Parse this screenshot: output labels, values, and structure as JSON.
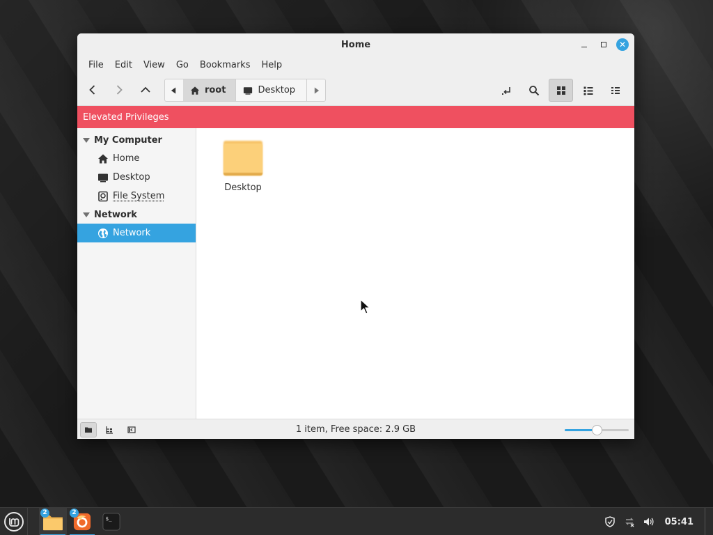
{
  "window": {
    "title": "Home"
  },
  "menubar": {
    "items": [
      "File",
      "Edit",
      "View",
      "Go",
      "Bookmarks",
      "Help"
    ]
  },
  "pathbar": {
    "crumbs": [
      {
        "label": "root",
        "icon": "home-icon",
        "active": true
      },
      {
        "label": "Desktop",
        "icon": "desktop-icon",
        "active": false
      }
    ]
  },
  "banner": {
    "text": "Elevated Privileges",
    "color": "#ef5060"
  },
  "sidebar": {
    "sections": [
      {
        "heading": "My Computer",
        "items": [
          {
            "label": "Home",
            "icon": "home-icon"
          },
          {
            "label": "Desktop",
            "icon": "desktop-icon"
          },
          {
            "label": "File System",
            "icon": "drive-icon"
          }
        ]
      },
      {
        "heading": "Network",
        "items": [
          {
            "label": "Network",
            "icon": "globe-icon",
            "selected": true
          }
        ]
      }
    ]
  },
  "files": [
    {
      "name": "Desktop",
      "icon": "folder-icon"
    }
  ],
  "statusbar": {
    "text": "1 item, Free space: 2.9 GB",
    "zoom_fraction": 0.5
  },
  "taskbar": {
    "apps": [
      {
        "name": "files",
        "icon": "folder-icon",
        "badge": "2"
      },
      {
        "name": "firefox",
        "icon": "firefox-icon",
        "badge": "2"
      },
      {
        "name": "terminal",
        "icon": "terminal-icon",
        "badge": ""
      }
    ],
    "clock": "05:41"
  },
  "colors": {
    "accent": "#35a3e0",
    "banner": "#ef5060"
  }
}
